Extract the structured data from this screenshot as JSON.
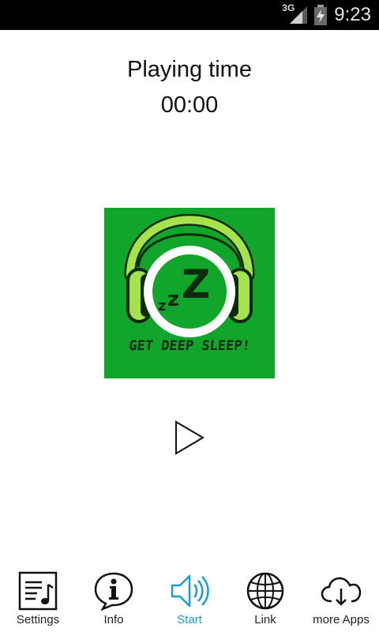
{
  "status_bar": {
    "network": "3G",
    "time": "9:23",
    "icons": [
      "signal-icon",
      "battery-charging-icon"
    ]
  },
  "player": {
    "title": "Playing time",
    "time": "00:00",
    "artwork_caption": "GET DEEP SLEEP!",
    "artwork_letters": [
      "z",
      "z",
      "Z"
    ],
    "play_icon": "play-icon"
  },
  "nav": {
    "items": [
      {
        "label": "Settings",
        "icon": "settings-list-icon"
      },
      {
        "label": "Info",
        "icon": "info-bubble-icon"
      },
      {
        "label": "Start",
        "icon": "speaker-icon",
        "active": true
      },
      {
        "label": "Link",
        "icon": "globe-icon"
      },
      {
        "label": "more Apps",
        "icon": "cloud-download-icon"
      }
    ],
    "active_color": "#1b9ad6"
  },
  "colors": {
    "artwork_bg": "#12a52b",
    "headphone_green": "#a6e24c",
    "status_bar": "#000000"
  }
}
